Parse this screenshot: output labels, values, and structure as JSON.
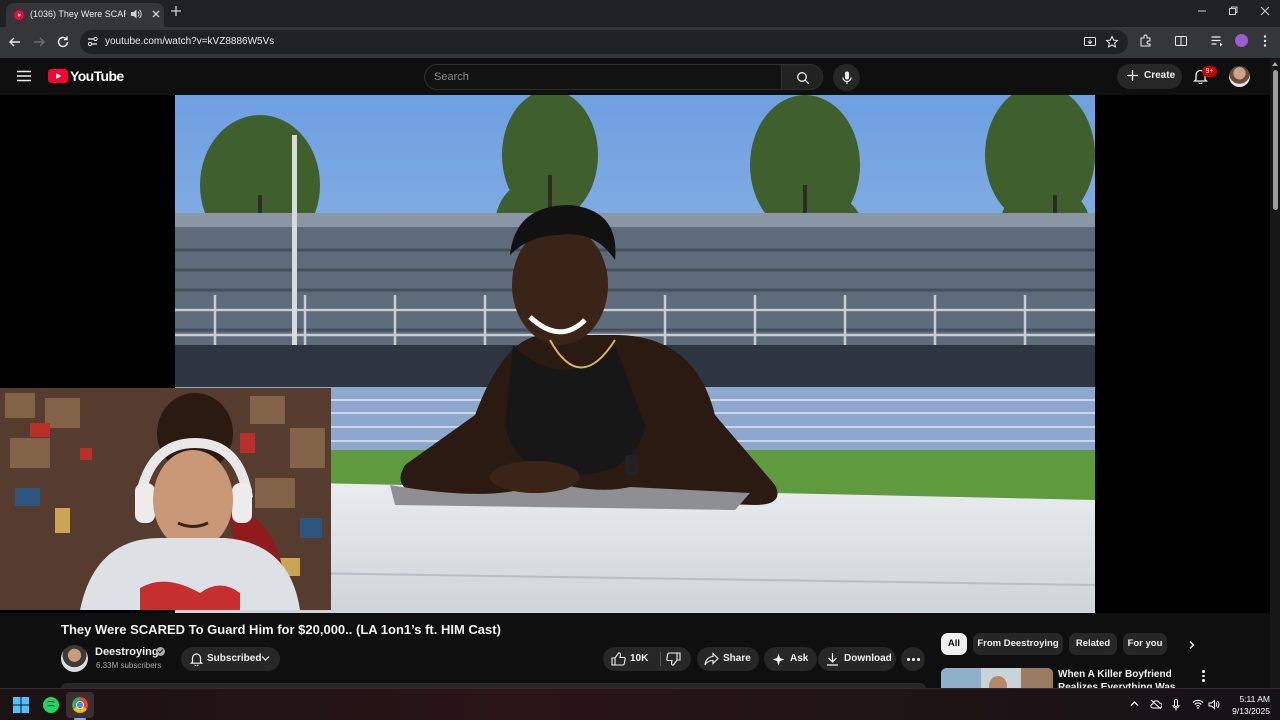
{
  "browser": {
    "tab_title": "(1036) They Were SCARED",
    "url": "youtube.com/watch?v=kVZ8886W5Vs"
  },
  "header": {
    "logo_text": "YouTube",
    "search_placeholder": "Search",
    "create_label": "Create",
    "notification_badge": "9+"
  },
  "video": {
    "title": "They Were SCARED To Guard Him for $20,000.. (LA 1on1’s ft. HIM Cast)",
    "channel": "Deestroying",
    "subscribers": "6.33M subscribers",
    "subscribed_label": "Subscribed",
    "likes": "10K",
    "share_label": "Share",
    "ask_label": "Ask",
    "download_label": "Download"
  },
  "sidebar": {
    "chips": [
      "All",
      "From Deestroying",
      "Related",
      "For you"
    ],
    "active_chip": "All",
    "recommended": [
      {
        "title": "When A Killer Boyfriend Realizes Everything Was"
      }
    ]
  },
  "taskbar": {
    "time": "5:11 AM",
    "date": "9/13/2025"
  },
  "colors": {
    "youtube_red": "#ff0033",
    "background": "#0f0f0f",
    "surface": "#272727"
  }
}
